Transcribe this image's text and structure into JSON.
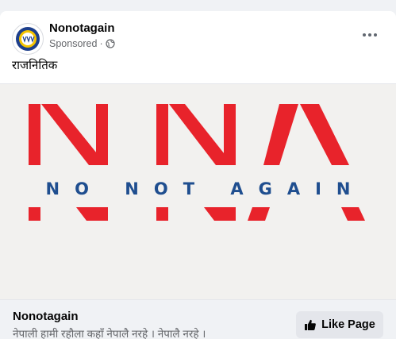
{
  "post": {
    "page_name": "Nonotagain",
    "sponsored_label": "Sponsored",
    "separator": "·",
    "privacy_icon": "globe-icon",
    "caption": "राजनितिक"
  },
  "media": {
    "logo_letters": "NNA",
    "tagline": "NO NOT AGAIN",
    "colors": {
      "red": "#e8232b",
      "blue": "#1f4e8f",
      "background": "#f2f1ef"
    }
  },
  "footer": {
    "title": "Nonotagain",
    "description": "नेपाली हामी रहौला कहाँ नेपालै नरहे । नेपालै नरहे ।",
    "like_button_label": "Like Page",
    "like_icon": "thumbs-up-icon"
  }
}
